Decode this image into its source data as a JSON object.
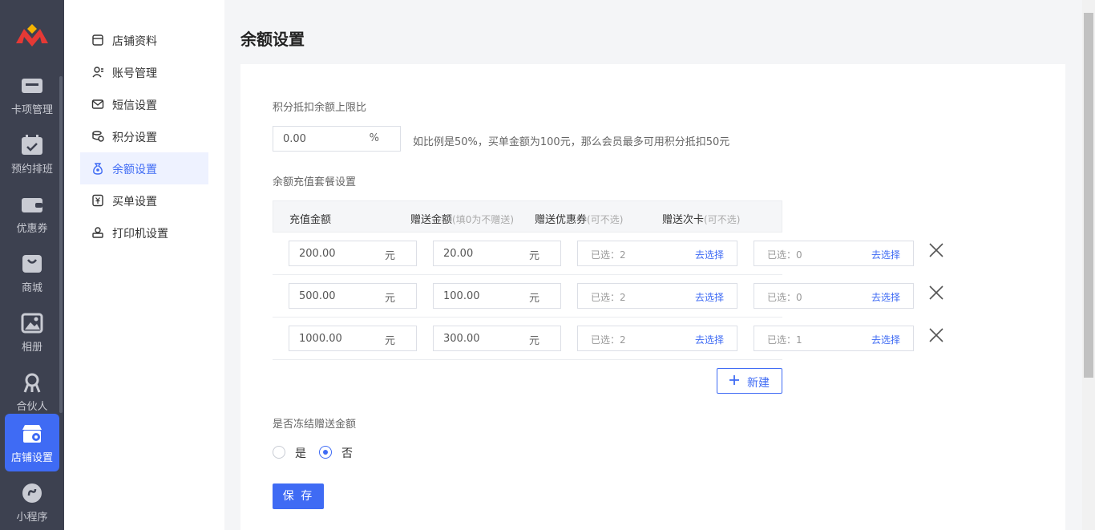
{
  "rail": {
    "items": [
      {
        "label": "卡项管理",
        "icon": "card-icon"
      },
      {
        "label": "预约排班",
        "icon": "calendar-icon"
      },
      {
        "label": "优惠券",
        "icon": "wallet-icon"
      },
      {
        "label": "商城",
        "icon": "bag-icon"
      },
      {
        "label": "相册",
        "icon": "image-icon"
      },
      {
        "label": "合伙人",
        "icon": "partner-icon"
      },
      {
        "label": "店铺设置",
        "icon": "store-settings-icon"
      },
      {
        "label": "小程序",
        "icon": "miniprogram-icon"
      }
    ],
    "active": "店铺设置"
  },
  "submenu": {
    "items": [
      {
        "label": "店铺资料",
        "icon": "store-icon"
      },
      {
        "label": "账号管理",
        "icon": "account-icon"
      },
      {
        "label": "短信设置",
        "icon": "mail-icon"
      },
      {
        "label": "积分设置",
        "icon": "points-icon"
      },
      {
        "label": "余额设置",
        "icon": "balance-icon"
      },
      {
        "label": "买单设置",
        "icon": "yen-icon"
      },
      {
        "label": "打印机设置",
        "icon": "printer-icon"
      }
    ],
    "active": "余额设置"
  },
  "page": {
    "title": "余额设置",
    "points_label": "积分抵扣余额上限比",
    "points_value": "0.00",
    "points_unit": "%",
    "points_hint": "如比例是50%，买单金额为100元，那么会员最多可用积分抵扣50元",
    "packages_label": "余额充值套餐设置",
    "table_headers": {
      "amount": "充值金额",
      "gift": "赠送金额",
      "gift_sub": "(填0为不赠送)",
      "coupon": "赠送优惠券",
      "coupon_sub": "(可不选)",
      "card": "赠送次卡",
      "card_sub": "(可不选)"
    },
    "unit_yuan": "元",
    "choose_link": "去选择",
    "rows": [
      {
        "amount": "200.00",
        "gift": "20.00",
        "coupon_selected": "已选：2",
        "card_selected": "已选：0"
      },
      {
        "amount": "500.00",
        "gift": "100.00",
        "coupon_selected": "已选：2",
        "card_selected": "已选：0"
      },
      {
        "amount": "1000.00",
        "gift": "300.00",
        "coupon_selected": "已选：2",
        "card_selected": "已选：1"
      }
    ],
    "new_button": "新建",
    "freeze_label": "是否冻结赠送金额",
    "freeze_options": [
      "是",
      "否"
    ],
    "freeze_selected": "否",
    "save_button": "保 存"
  },
  "colors": {
    "accent": "#3f6bf4",
    "rail_bg": "#3d4150"
  }
}
